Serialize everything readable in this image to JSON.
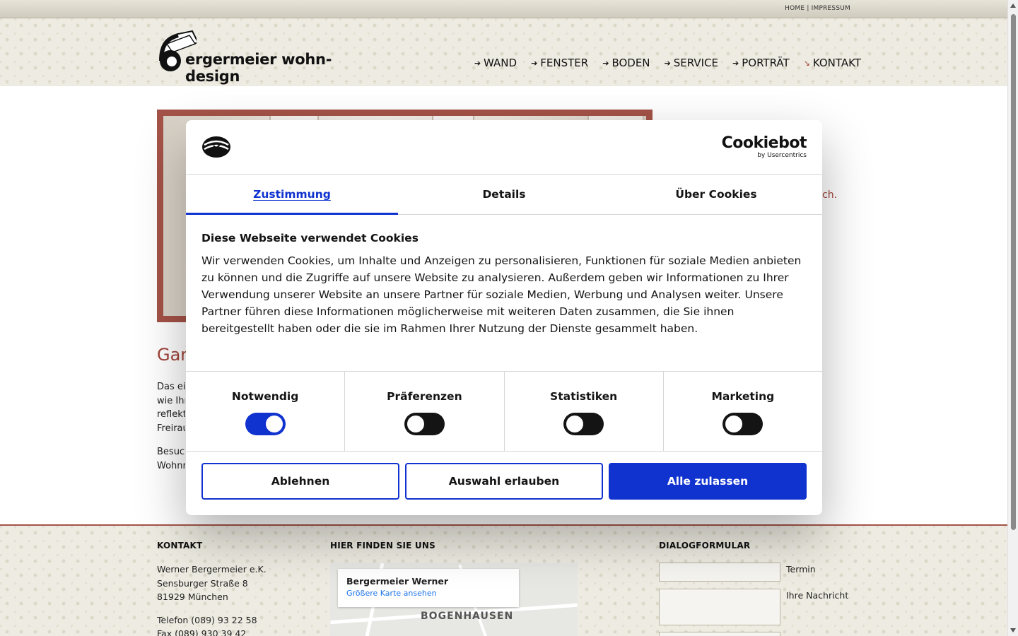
{
  "top_links": {
    "home": "HOME",
    "separator": "|",
    "impressum": "IMPRESSUM"
  },
  "logo": {
    "text": "ergermeier wohn-design"
  },
  "nav": [
    {
      "label": "WAND",
      "icon": "arrow-right-icon"
    },
    {
      "label": "FENSTER",
      "icon": "arrow-right-icon"
    },
    {
      "label": "BODEN",
      "icon": "arrow-right-icon"
    },
    {
      "label": "SERVICE",
      "icon": "arrow-right-icon"
    },
    {
      "label": "PORTRÄT",
      "icon": "arrow-right-icon"
    },
    {
      "label": "KONTAKT",
      "icon": "arrow-down-right-icon",
      "active": true
    }
  ],
  "content": {
    "title": "Gan",
    "p1": [
      "Das ei",
      "wie Ihr",
      "reflekt",
      "Freirau"
    ],
    "p2": [
      "Besuch",
      "Wohnr"
    ],
    "side_text": "ch."
  },
  "footer": {
    "kontakt": {
      "heading": "KONTAKT",
      "lines": [
        "Werner Bergermeier e.K.",
        "Sensburger Straße 8",
        "81929 München"
      ],
      "telefon": "Telefon (089) 93 22 58",
      "fax": "Fax (089) 930 39 42"
    },
    "map": {
      "heading": "HIER FINDEN SIE UNS",
      "place_name": "Bergermeier Werner",
      "link": "Größere Karte ansehen",
      "area_label": "BOGENHAUSEN"
    },
    "form": {
      "heading": "DIALOGFORMULAR",
      "termin_label": "Termin",
      "nachricht_label": "Ihre Nachricht"
    }
  },
  "cookie_dialog": {
    "brand": "Cookiebot",
    "brand_sub": "by Usercentrics",
    "tabs": [
      {
        "label": "Zustimmung",
        "active": true
      },
      {
        "label": "Details",
        "active": false
      },
      {
        "label": "Über Cookies",
        "active": false
      }
    ],
    "title": "Diese Webseite verwendet Cookies",
    "text": "Wir verwenden Cookies, um Inhalte und Anzeigen zu personalisieren, Funktionen für soziale Medien anbieten zu können und die Zugriffe auf unsere Website zu analysieren. Außerdem geben wir Informationen zu Ihrer Verwendung unserer Website an unsere Partner für soziale Medien, Werbung und Analysen weiter. Unsere Partner führen diese Informationen möglicherweise mit weiteren Daten zusammen, die Sie ihnen bereitgestellt haben oder die sie im Rahmen Ihrer Nutzung der Dienste gesammelt haben.",
    "categories": [
      {
        "label": "Notwendig",
        "on": true
      },
      {
        "label": "Präferenzen",
        "on": false
      },
      {
        "label": "Statistiken",
        "on": false
      },
      {
        "label": "Marketing",
        "on": false
      }
    ],
    "buttons": {
      "decline": "Ablehnen",
      "allow_selection": "Auswahl erlauben",
      "allow_all": "Alle zulassen"
    },
    "colors": {
      "accent": "#1032cf"
    }
  },
  "colors": {
    "brand_red": "#a55348",
    "header_bg": "#eeece2"
  }
}
